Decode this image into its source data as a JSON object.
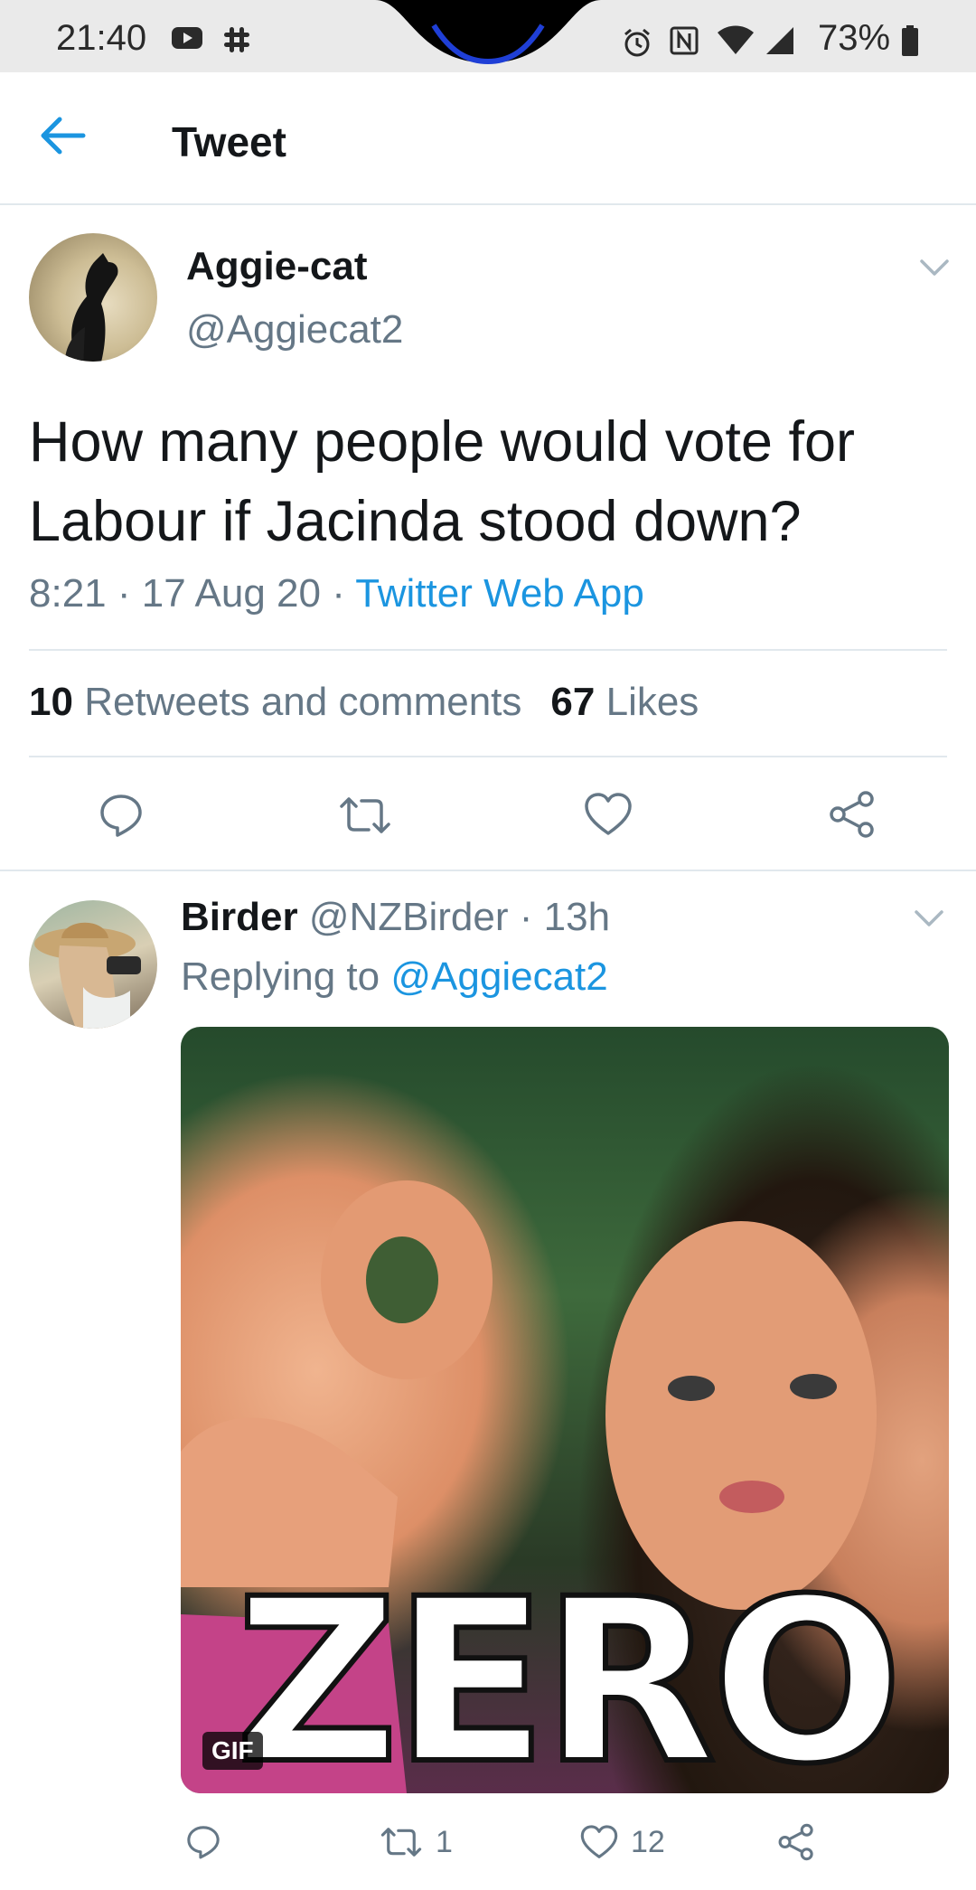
{
  "status_bar": {
    "time": "21:40",
    "battery": "73%",
    "icons": [
      "youtube-icon",
      "slack-icon",
      "alarm-icon",
      "nfc-icon",
      "wifi-icon",
      "signal-icon",
      "battery-icon"
    ]
  },
  "header": {
    "title": "Tweet",
    "back_icon": "arrow-left-icon"
  },
  "tweet": {
    "author_name": "Aggie-cat",
    "author_handle": "@Aggiecat2",
    "text": "How many people would vote for Labour if Jacinda stood down?",
    "time": "8:21",
    "date": "17 Aug 20",
    "source": "Twitter Web App",
    "retweets_count": "10",
    "retweets_label": "Retweets and comments",
    "likes_count": "67",
    "likes_label": "Likes"
  },
  "reply": {
    "author_name": "Birder",
    "author_handle": "@NZBirder",
    "age": "13h",
    "replying_prefix": "Replying to",
    "replying_mention": "@Aggiecat2",
    "gif_caption": "ZERO",
    "gif_badge": "GIF",
    "retweet_count": "1",
    "like_count": "12"
  },
  "colors": {
    "accent": "#1b95e0",
    "secondary_text": "#657786",
    "primary_text": "#14171a",
    "divider": "#e1e8ed"
  }
}
